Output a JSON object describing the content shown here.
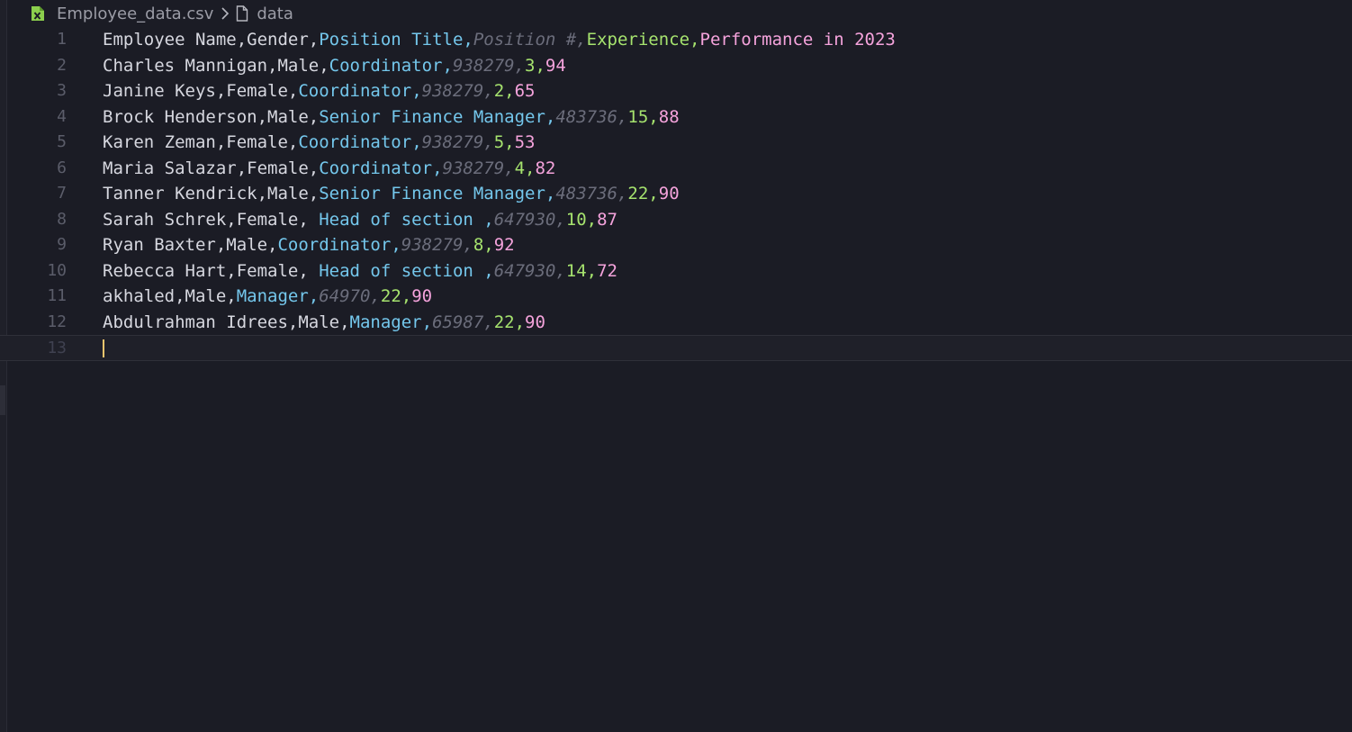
{
  "breadcrumb": {
    "file_name": "Employee_data.csv",
    "symbol": "data",
    "file_icon": "csv-file-icon",
    "symbol_icon": "document-icon",
    "icon_color": "#8ccf4d"
  },
  "editor": {
    "lines": [
      {
        "no": "1",
        "cells": [
          "Employee Name",
          "Gender",
          "Position Title",
          "Position #",
          "Experience",
          "Performance in 2023"
        ]
      },
      {
        "no": "2",
        "cells": [
          "Charles Mannigan",
          "Male",
          "Coordinator",
          "938279",
          "3",
          "94"
        ]
      },
      {
        "no": "3",
        "cells": [
          "Janine Keys",
          "Female",
          "Coordinator",
          "938279",
          "2",
          "65"
        ]
      },
      {
        "no": "4",
        "cells": [
          "Brock Henderson",
          "Male",
          "Senior Finance Manager",
          "483736",
          "15",
          "88"
        ]
      },
      {
        "no": "5",
        "cells": [
          "Karen Zeman",
          "Female",
          "Coordinator",
          "938279",
          "5",
          "53"
        ]
      },
      {
        "no": "6",
        "cells": [
          "Maria Salazar",
          "Female",
          "Coordinator",
          "938279",
          "4",
          "82"
        ]
      },
      {
        "no": "7",
        "cells": [
          "Tanner Kendrick",
          "Male",
          "Senior Finance Manager",
          "483736",
          "22",
          "90"
        ]
      },
      {
        "no": "8",
        "cells": [
          "Sarah Schrek",
          "Female",
          " Head of section ",
          "647930",
          "10",
          "87"
        ]
      },
      {
        "no": "9",
        "cells": [
          "Ryan Baxter",
          "Male",
          "Coordinator",
          "938279",
          "8",
          "92"
        ]
      },
      {
        "no": "10",
        "cells": [
          "Rebecca Hart",
          "Female",
          " Head of section ",
          "647930",
          "14",
          "72"
        ]
      },
      {
        "no": "11",
        "cells": [
          "akhaled",
          "Male",
          "Manager",
          "64970",
          "22",
          "90"
        ]
      },
      {
        "no": "12",
        "cells": [
          "Abdulrahman Idrees",
          "Male",
          "Manager",
          "65987",
          "22",
          "90"
        ]
      },
      {
        "no": "13",
        "cells": []
      }
    ],
    "column_colors": [
      "#d6d7df",
      "#d6d7df",
      "#74c7ec",
      "#6b6d7b",
      "#a6e36e",
      "#f5a3dc"
    ],
    "cursor_line": "13"
  }
}
